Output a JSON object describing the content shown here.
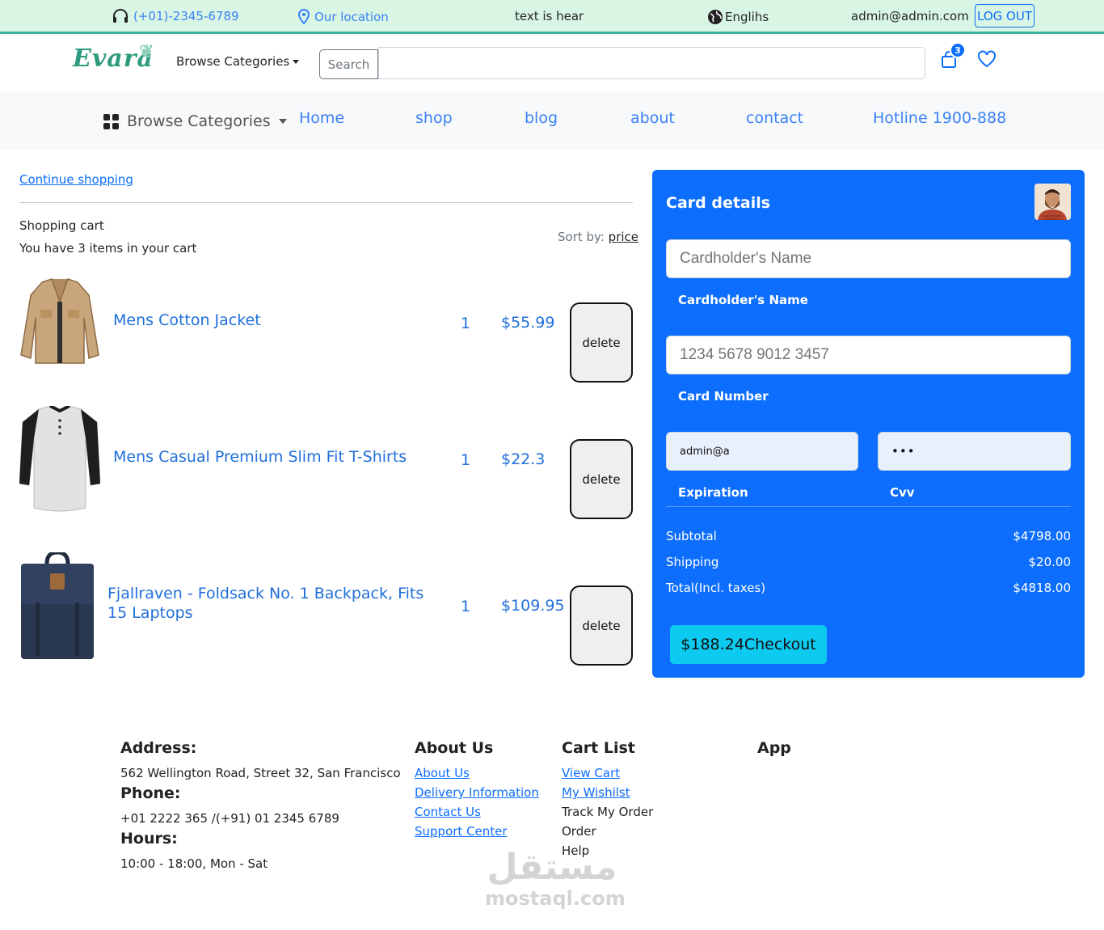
{
  "topbar": {
    "phone": "(+01)-2345-6789",
    "location": "Our location",
    "promo": "text is hear",
    "language": "Englihs",
    "email": "admin@admin.com",
    "logout": "LOG OUT"
  },
  "header": {
    "logo": "Evara",
    "browse": "Browse Categories",
    "search_label": "Search",
    "search_value": "",
    "cart_count": "3"
  },
  "nav": {
    "browse": "Browse Categories",
    "links": [
      "Home",
      "shop",
      "blog",
      "about",
      "contact",
      "Hotline 1900-888"
    ]
  },
  "cart": {
    "continue": "Continue shopping",
    "title": "Shopping cart",
    "subtitle": "You have 3 items in your cart",
    "sort_label": "Sort by:",
    "sort_value": "price",
    "delete_label": "delete",
    "items": [
      {
        "name": "Mens Cotton Jacket",
        "qty": "1",
        "price": "$55.99"
      },
      {
        "name": "Mens Casual Premium Slim Fit T-Shirts",
        "qty": "1",
        "price": "$22.3"
      },
      {
        "name": "Fjallraven - Foldsack No. 1 Backpack, Fits 15 Laptops",
        "qty": "1",
        "price": "$109.95"
      }
    ]
  },
  "card": {
    "title": "Card details",
    "name_placeholder": "Cardholder's Name",
    "name_label": "Cardholder's Name",
    "number_placeholder": "1234 5678 9012 3457",
    "number_label": "Card Number",
    "expiration_value": "admin@a",
    "expiration_label": "Expiration",
    "cvv_value": "•••",
    "cvv_label": "Cvv",
    "subtotal_label": "Subtotal",
    "subtotal": "$4798.00",
    "shipping_label": "Shipping",
    "shipping": "$20.00",
    "total_label": "Total(Incl. taxes)",
    "total": "$4818.00",
    "checkout": "$188.24Checkout"
  },
  "footer": {
    "address_head": "Address:",
    "address": "562 Wellington Road, Street 32, San Francisco",
    "phone_head": "Phone:",
    "phone": "+01 2222 365 /(+91) 01 2345 6789",
    "hours_head": "Hours:",
    "hours": "10:00 - 18:00, Mon - Sat",
    "about_head": "About Us",
    "about_links": [
      "About Us",
      "Delivery Information",
      "Contact Us",
      "Support Center"
    ],
    "cart_head": "Cart List",
    "cart_links": [
      "View Cart",
      "My Wishilst"
    ],
    "cart_texts": [
      "Track My Order",
      "Order",
      "Help"
    ],
    "app_head": "App"
  },
  "watermark": {
    "arabic": "مستقل",
    "latin": "mostaql.com"
  },
  "colors": {
    "primary": "#0d6efd",
    "topbar": "#d9f5e3",
    "accent": "#3bb39a",
    "checkout": "#0dcaf0"
  }
}
